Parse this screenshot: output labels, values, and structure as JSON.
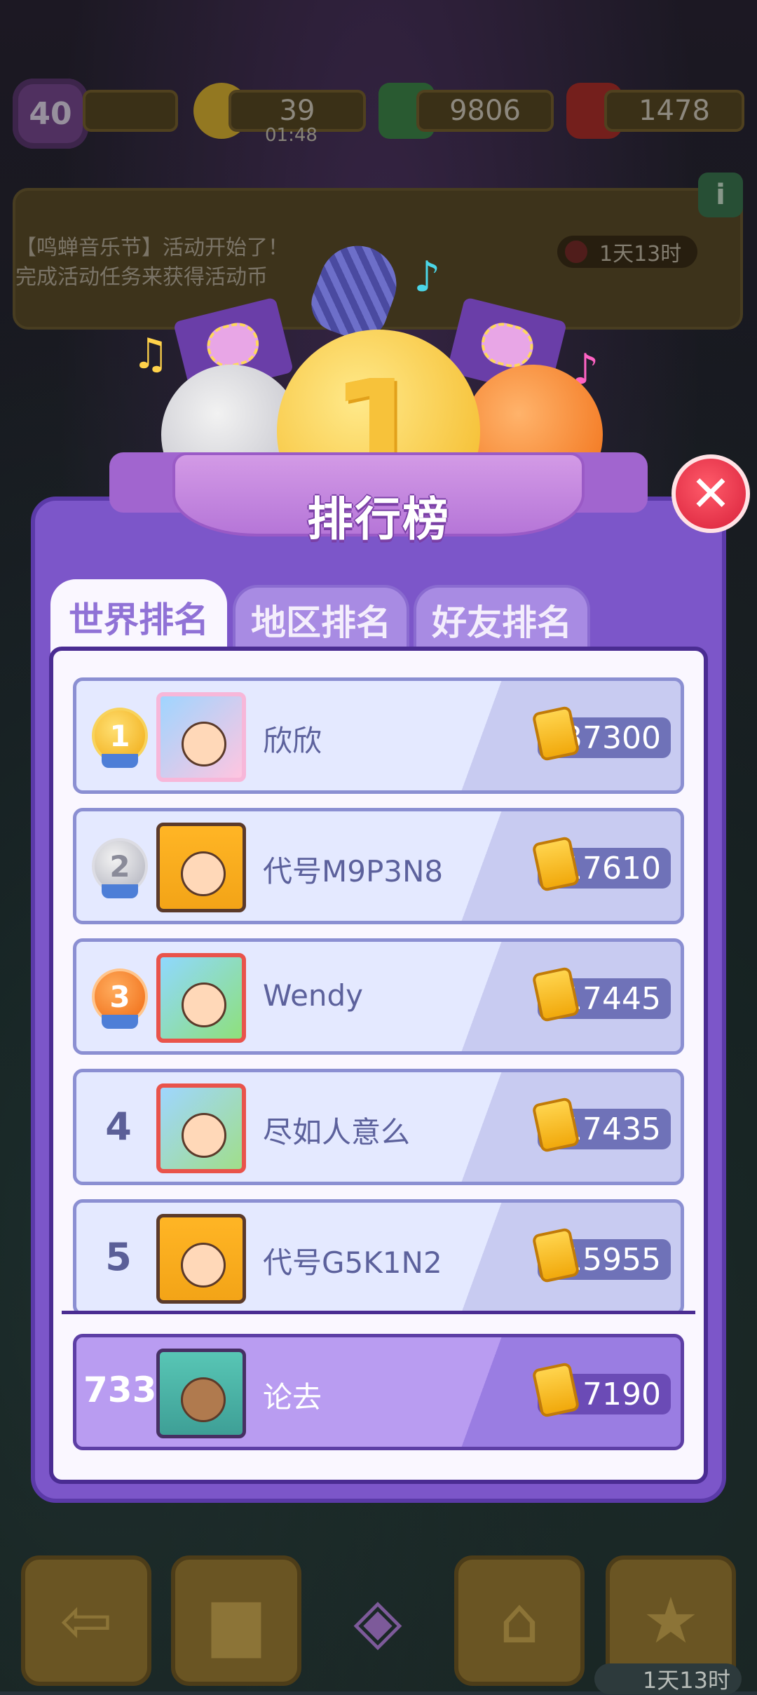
{
  "top_bar": {
    "level": "40",
    "energy": "39",
    "energy_timer": "01:48",
    "cash": "9806",
    "gems": "1478"
  },
  "banner": {
    "line1": "【鸣蝉音乐节】活动开始了！",
    "line2": "完成活动任务来获得活动币",
    "timer": "1天13时",
    "info_icon": "info-icon"
  },
  "leaderboard": {
    "title": "排行榜",
    "close_icon": "close-icon",
    "tabs": [
      {
        "label": "世界排名",
        "active": true
      },
      {
        "label": "地区排名",
        "active": false
      },
      {
        "label": "好友排名",
        "active": false
      }
    ],
    "rows": [
      {
        "rank": "1",
        "name": "欣欣",
        "score": "37300"
      },
      {
        "rank": "2",
        "name": "代号M9P3N8",
        "score": "17610"
      },
      {
        "rank": "3",
        "name": "Wendy",
        "score": "17445"
      },
      {
        "rank": "4",
        "name": "尽如人意么",
        "score": "17435"
      },
      {
        "rank": "5",
        "name": "代号G5K1N2",
        "score": "15955"
      }
    ],
    "me": {
      "rank": "733",
      "name": "论去",
      "score": "7190"
    }
  },
  "bottom_nav": {
    "timer": "1天13时",
    "items": [
      "back-arrow-icon",
      "podium-icon",
      "gift-box-icon",
      "basket-icon",
      "clipboard-star-icon"
    ]
  },
  "colors": {
    "panel": "#7c56c9",
    "close": "#d8203a",
    "row": "#e4e9ff",
    "score_pill": "#6f72b8"
  }
}
